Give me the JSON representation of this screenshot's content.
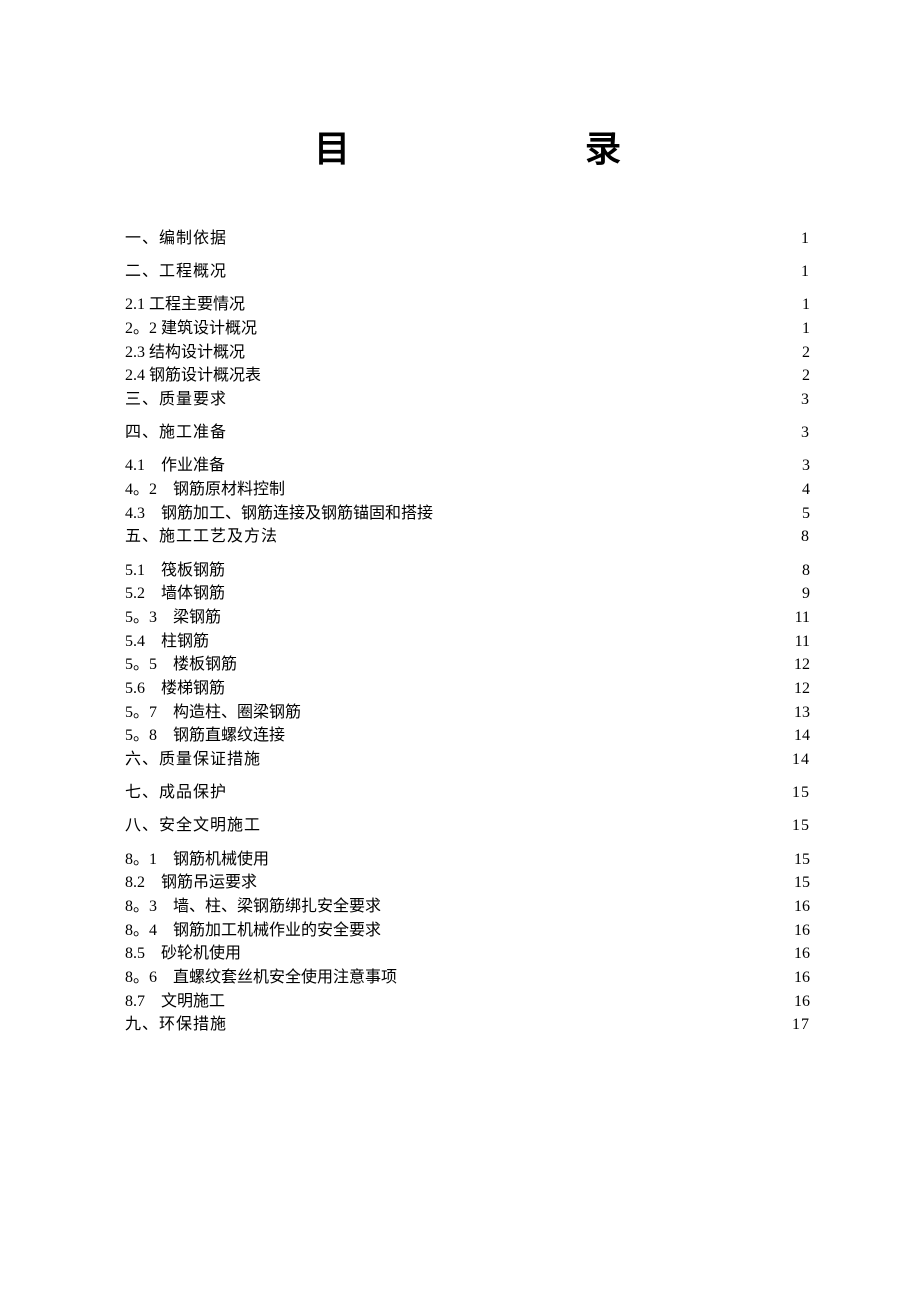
{
  "title": {
    "char1": "目",
    "char2": "录"
  },
  "entries": [
    {
      "type": "main",
      "label": "一、编制依据",
      "page": "1"
    },
    {
      "type": "main",
      "label": "二、工程概况",
      "page": "1"
    },
    {
      "type": "sub",
      "label": "2.1  工程主要情况",
      "page": "1"
    },
    {
      "type": "sub",
      "label": "2。2  建筑设计概况",
      "page": "1"
    },
    {
      "type": "sub",
      "label": "2.3 结构设计概况",
      "page": "2"
    },
    {
      "type": "sub",
      "label": "2.4 钢筋设计概况表",
      "page": "2"
    },
    {
      "type": "main",
      "label": "三、质量要求",
      "page": "3"
    },
    {
      "type": "main",
      "label": "四、施工准备",
      "page": "3"
    },
    {
      "type": "sub",
      "label": "4.1　作业准备",
      "page": "3"
    },
    {
      "type": "sub",
      "label": "4。2　钢筋原材料控制",
      "page": "4"
    },
    {
      "type": "sub",
      "label": "4.3　钢筋加工、钢筋连接及钢筋锚固和搭接",
      "page": "5"
    },
    {
      "type": "main",
      "label": "五、施工工艺及方法",
      "page": "8"
    },
    {
      "type": "sub",
      "label": "5.1　筏板钢筋",
      "page": "8"
    },
    {
      "type": "sub",
      "label": "5.2　墙体钢筋",
      "page": "9"
    },
    {
      "type": "sub",
      "label": "5。3　梁钢筋",
      "page": "11"
    },
    {
      "type": "sub",
      "label": "5.4　柱钢筋",
      "page": "11"
    },
    {
      "type": "sub",
      "label": "5。5　楼板钢筋",
      "page": "12"
    },
    {
      "type": "sub",
      "label": "5.6　楼梯钢筋",
      "page": "12"
    },
    {
      "type": "sub",
      "label": "5。7　构造柱、圈梁钢筋",
      "page": "13"
    },
    {
      "type": "sub",
      "label": "5。8　钢筋直螺纹连接",
      "page": "14"
    },
    {
      "type": "main",
      "label": "六、质量保证措施",
      "page": "14"
    },
    {
      "type": "main",
      "label": "七、成品保护",
      "page": "15"
    },
    {
      "type": "main",
      "label": "八、安全文明施工",
      "page": "15"
    },
    {
      "type": "sub",
      "label": "8。1　钢筋机械使用",
      "page": "15"
    },
    {
      "type": "sub",
      "label": "8.2　钢筋吊运要求",
      "page": "15"
    },
    {
      "type": "sub",
      "label": "8。3　墙、柱、梁钢筋绑扎安全要求",
      "page": "16"
    },
    {
      "type": "sub",
      "label": "8。4　钢筋加工机械作业的安全要求",
      "page": "16"
    },
    {
      "type": "sub",
      "label": "8.5　砂轮机使用",
      "page": "16"
    },
    {
      "type": "sub",
      "label": "8。6　直螺纹套丝机安全使用注意事项",
      "page": "16"
    },
    {
      "type": "sub",
      "label": "8.7　文明施工",
      "page": "16"
    },
    {
      "type": "main",
      "label": "九、环保措施",
      "page": "17"
    }
  ]
}
